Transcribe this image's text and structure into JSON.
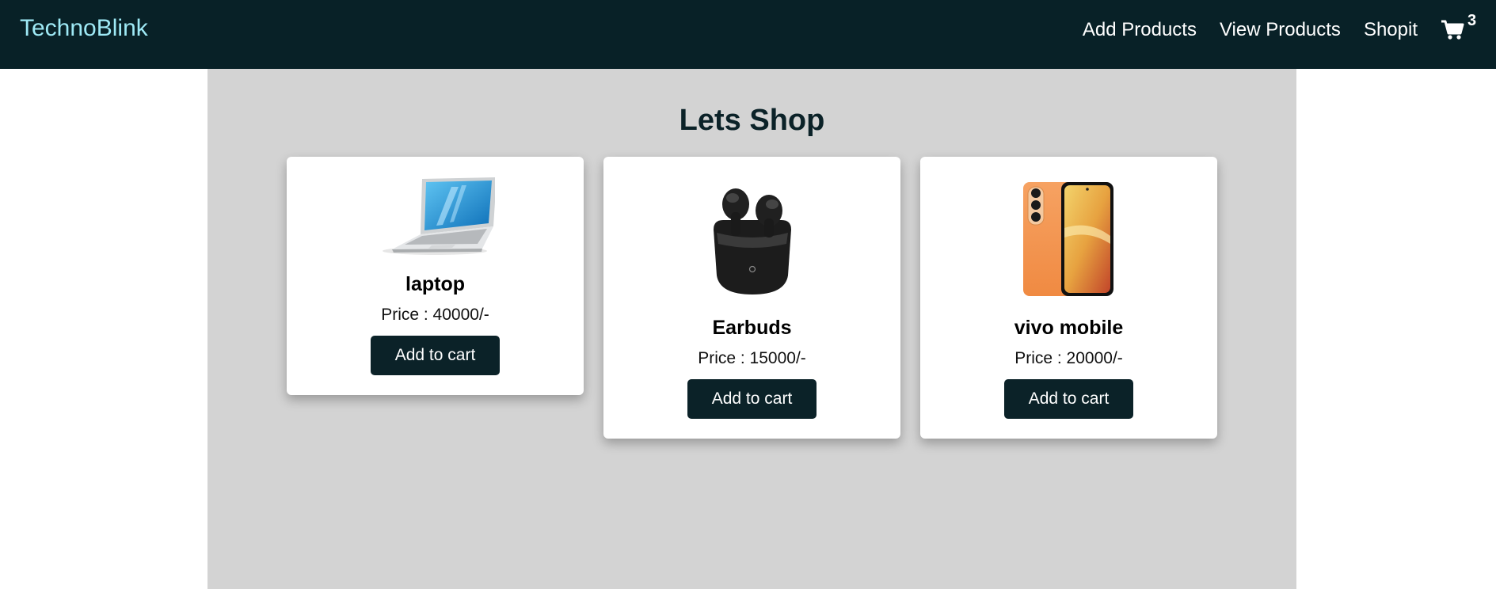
{
  "navbar": {
    "brand": "TechnoBlink",
    "links": [
      "Add Products",
      "View Products",
      "Shopit"
    ],
    "cart_count": "3",
    "cart_icon": "shopping-cart-icon",
    "colors": {
      "background": "#082127",
      "brand": "#9ee9f5",
      "link": "#ffffff"
    }
  },
  "main": {
    "title": "Lets Shop",
    "background": "#d3d3d3",
    "products": [
      {
        "name": "laptop",
        "price": "Price : 40000/-",
        "button": "Add to cart",
        "image": "laptop-image"
      },
      {
        "name": "Earbuds",
        "price": "Price : 15000/-",
        "button": "Add to cart",
        "image": "earbuds-image"
      },
      {
        "name": "vivo mobile",
        "price": "Price : 20000/-",
        "button": "Add to cart",
        "image": "phone-image"
      }
    ]
  }
}
